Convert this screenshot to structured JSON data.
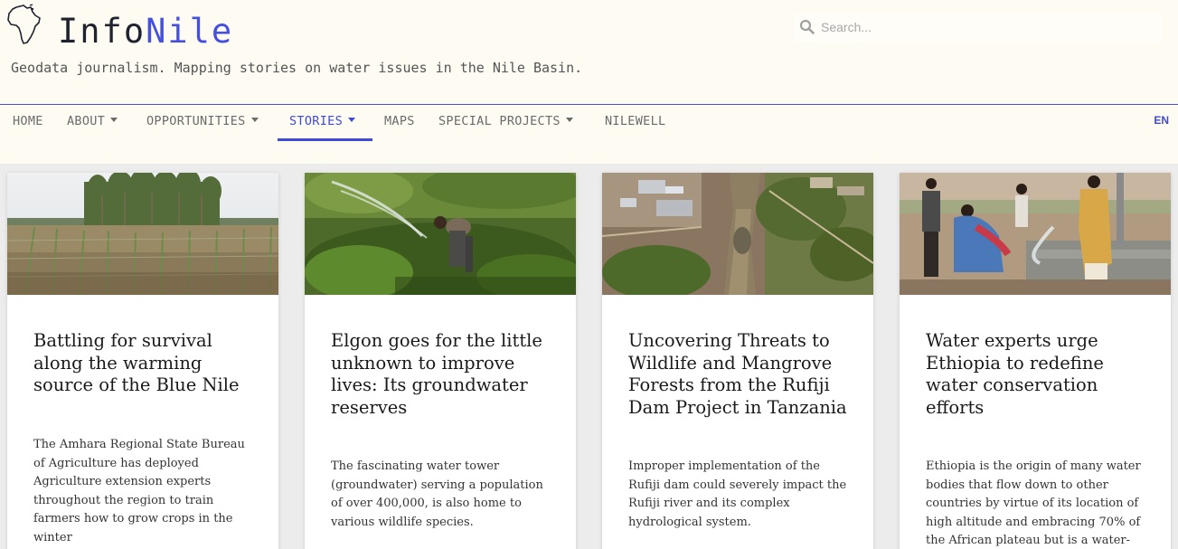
{
  "site": {
    "logo_part1": "Info",
    "logo_part2": "Nile",
    "tagline": "Geodata journalism. Mapping stories on water issues in the Nile Basin.",
    "accent": "#4650e0",
    "header_bg": "#fefcf2"
  },
  "search": {
    "placeholder": "Search..."
  },
  "nav": {
    "items": [
      {
        "label": "HOME",
        "has_dropdown": false
      },
      {
        "label": "ABOUT",
        "has_dropdown": true
      },
      {
        "label": "OPPORTUNITIES",
        "has_dropdown": true
      },
      {
        "label": "STORIES",
        "has_dropdown": true,
        "active": true
      },
      {
        "label": "MAPS",
        "has_dropdown": false
      },
      {
        "label": "SPECIAL PROJECTS",
        "has_dropdown": true
      },
      {
        "label": "NILEWELL",
        "has_dropdown": false
      }
    ],
    "language": "EN"
  },
  "stories": [
    {
      "image": "farm-field-with-eucalyptus-trees",
      "title": "Battling for survival along the warming source of the Blue Nile",
      "excerpt": "The Amhara Regional State Bureau of Agriculture has deployed Agriculture extension experts throughout the region to train farmers how to grow crops in the winter"
    },
    {
      "image": "man-watering-crops-with-hose",
      "title": "Elgon goes for the little unknown to improve lives: Its groundwater reserves",
      "excerpt": "The fascinating water tower (groundwater) serving a population of over 400,000, is also home to various wildlife species."
    },
    {
      "image": "aerial-view-of-dam-construction",
      "title": "Uncovering Threats to Wildlife and Mangrove Forests from the Rufiji Dam Project in Tanzania",
      "excerpt": "Improper implementation of the Rufiji dam could severely impact the Rufiji river and its complex hydrological system."
    },
    {
      "image": "people-collecting-water-at-pump",
      "title": "Water experts urge Ethiopia to redefine water conservation efforts",
      "excerpt": "Ethiopia is the origin of many water bodies that flow down to other countries by virtue of its location of high altitude and embracing 70% of the African plateau but is a water-"
    }
  ]
}
